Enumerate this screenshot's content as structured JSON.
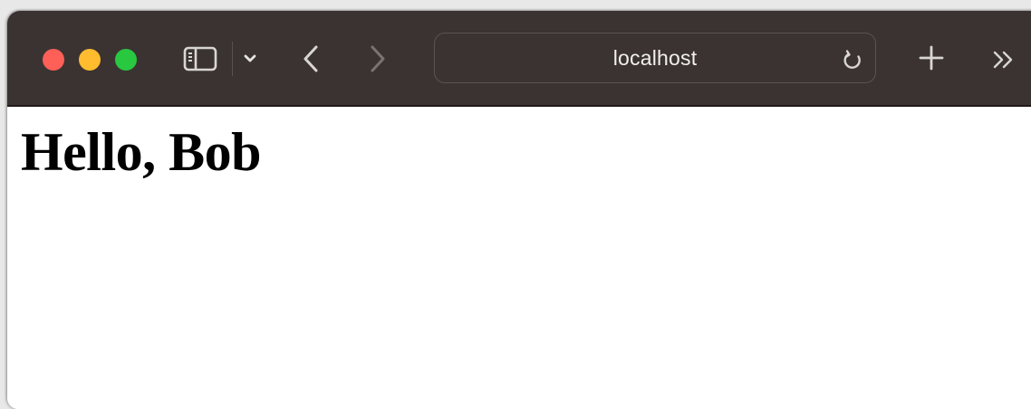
{
  "browser": {
    "traffic_lights": {
      "close_color": "#fe5f57",
      "minimize_color": "#febc2e",
      "zoom_color": "#28c840"
    },
    "toolbar_color": "#3b3331",
    "icons": {
      "sidebar": "sidebar-icon",
      "tab_overview": "chevron-down-icon",
      "back": "chevron-left-icon",
      "forward": "chevron-right-icon",
      "reload": "reload-icon",
      "new_tab": "plus-icon",
      "more": "double-chevron-right-icon"
    },
    "address": "localhost"
  },
  "page": {
    "heading": "Hello, Bob"
  }
}
